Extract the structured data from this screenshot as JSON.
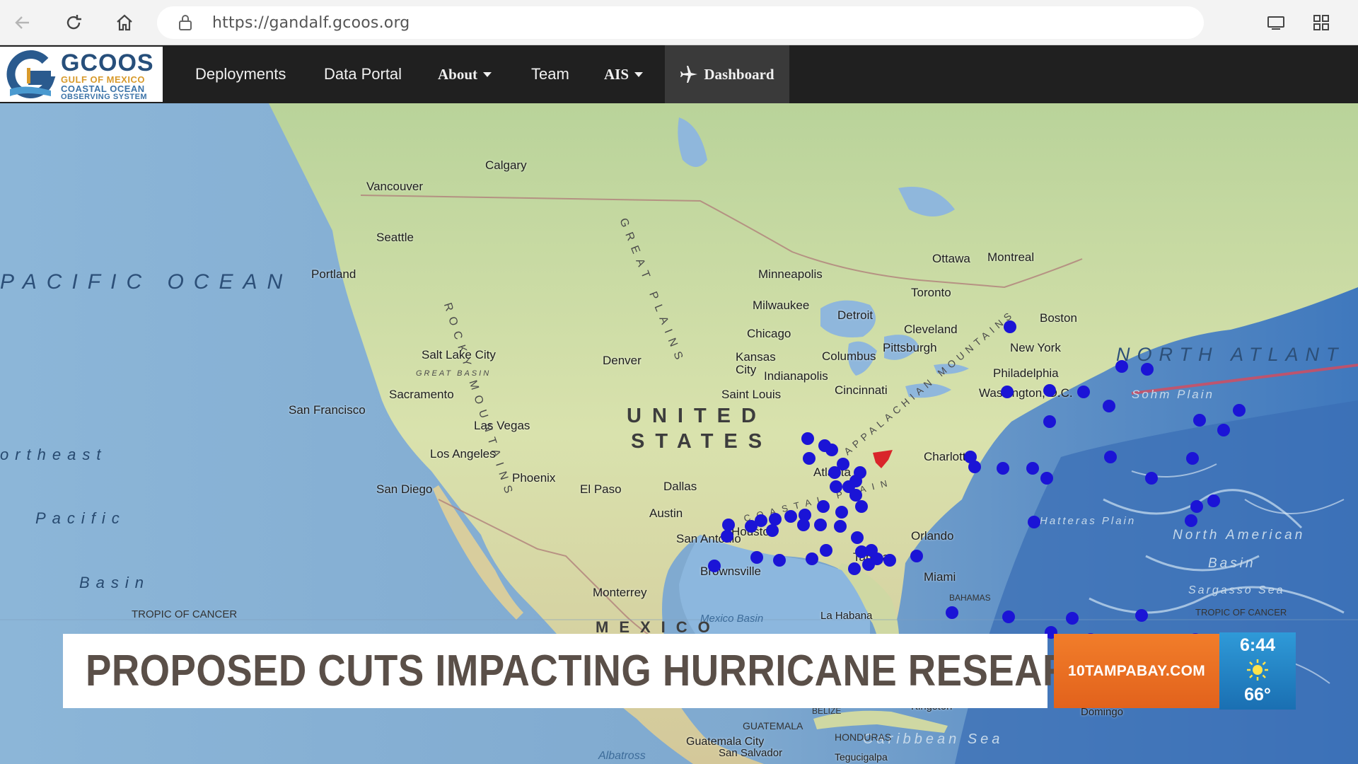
{
  "browser": {
    "url": "https://gandalf.gcoos.org",
    "icons": [
      "back-arrow-icon",
      "reload-icon",
      "home-icon",
      "lock-icon",
      "reader-view-icon",
      "extensions-icon"
    ]
  },
  "site_nav": {
    "logo": {
      "title": "GCOOS",
      "line1": "GULF OF MEXICO",
      "line2": "COASTAL OCEAN",
      "line3": "OBSERVING SYSTEM"
    },
    "items": [
      {
        "label": "Deployments"
      },
      {
        "label": "Data Portal"
      },
      {
        "label": "About",
        "dropdown": true
      },
      {
        "label": "Team"
      },
      {
        "label": "AIS",
        "dropdown": true
      }
    ],
    "dashboard": {
      "label": "Dashboard",
      "icon": "airplane-icon"
    }
  },
  "map": {
    "oceans": {
      "pacific": "PACIFIC OCEAN",
      "atlantic": "NORTH ATLANT",
      "northeast": "ortheast",
      "pacific_basin_1": "Pacific",
      "pacific_basin_2": "Basin"
    },
    "country_us_1": "UNITED",
    "country_us_2": "STATES",
    "country_mexico": "MEXICO",
    "tropic": "TROPIC OF CANCER",
    "tropic_right": "TROPIC OF CANCER",
    "rocky": "ROCKY MOUNTAINS",
    "great_plains": "GREAT PLAINS",
    "appalachian": "APPALACHIAN MOUNTAINS",
    "coastal_plain": "COASTAL PLAIN",
    "great_basin": "GREAT BASIN",
    "labels": {
      "sohm": "Sohm Plain",
      "hatteras": "Hatteras Plain",
      "na_basin_1": "North American",
      "na_basin_2": "Basin",
      "sargasso": "Sargasso Sea",
      "mexico_basin": "Mexico Basin",
      "caribbean": "Caribbean Sea",
      "bahamas": "BAHAMAS",
      "guatemala": "GUATEMALA",
      "honduras": "HONDURAS",
      "belize": "BELIZE",
      "albatross": "Albatross",
      "la_habana": "La Habana",
      "kingston": "Kingston",
      "domingo": "Domingo",
      "guatemala_city": "Guatemala City",
      "san_salvador": "San Salvador",
      "tegucigalpa": "Tegucigalpa"
    },
    "cities": [
      {
        "name": "Calgary"
      },
      {
        "name": "Vancouver"
      },
      {
        "name": "Seattle"
      },
      {
        "name": "Portland"
      },
      {
        "name": "Minneapolis"
      },
      {
        "name": "Milwaukee"
      },
      {
        "name": "Ottawa"
      },
      {
        "name": "Montreal"
      },
      {
        "name": "Toronto"
      },
      {
        "name": "Detroit"
      },
      {
        "name": "Chicago"
      },
      {
        "name": "Cleveland"
      },
      {
        "name": "Boston"
      },
      {
        "name": "Salt Lake City"
      },
      {
        "name": "Denver"
      },
      {
        "name": "Kansas City"
      },
      {
        "name": "Columbus"
      },
      {
        "name": "Pittsburgh"
      },
      {
        "name": "New York"
      },
      {
        "name": "Indianapolis"
      },
      {
        "name": "Philadelphia"
      },
      {
        "name": "Sacramento"
      },
      {
        "name": "Cincinnati"
      },
      {
        "name": "Washington, D.C."
      },
      {
        "name": "San Francisco"
      },
      {
        "name": "Saint Louis"
      },
      {
        "name": "Las Vegas"
      },
      {
        "name": "Los Angeles"
      },
      {
        "name": "Charlotte"
      },
      {
        "name": "Phoenix"
      },
      {
        "name": "Atlanta"
      },
      {
        "name": "San Diego"
      },
      {
        "name": "El Paso"
      },
      {
        "name": "Dallas"
      },
      {
        "name": "Austin"
      },
      {
        "name": "Houston"
      },
      {
        "name": "San Antonio"
      },
      {
        "name": "Orlando"
      },
      {
        "name": "Tampa"
      },
      {
        "name": "Brownsville"
      },
      {
        "name": "Miami"
      },
      {
        "name": "Monterrey"
      }
    ],
    "deployment_marker_color": "#1b14d6",
    "highlight_marker_color": "#d9252a",
    "deployment_count": 68
  },
  "lower_third": {
    "headline": "PROPOSED CUTS IMPACTING HURRICANE RESEARCH",
    "station": "10TAMPABAY.COM",
    "time": "6:44",
    "temperature": "66°",
    "weather_icon": "sun-icon"
  }
}
